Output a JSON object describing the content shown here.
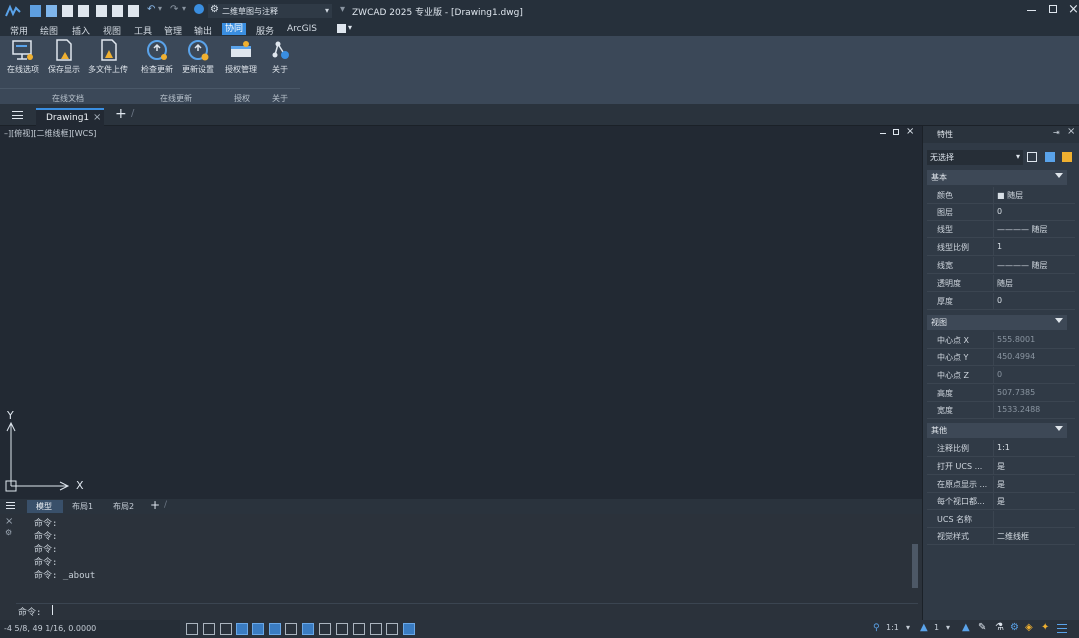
{
  "window": {
    "title": "ZWCAD 2025 专业版 - [Drawing1.dwg]",
    "workspace": "二维草图与注释"
  },
  "menu": {
    "items": [
      "常用",
      "绘图",
      "插入",
      "视图",
      "工具",
      "管理",
      "输出",
      "协同",
      "服务",
      "ArcGIS"
    ],
    "active": "协同"
  },
  "ribbon": {
    "buttons": [
      "在线选项",
      "保存显示",
      "多文件上传",
      "检查更新",
      "更新设置",
      "授权管理",
      "关于"
    ],
    "groups": [
      "在线文档",
      "在线更新",
      "授权",
      "关于"
    ]
  },
  "doc_tab": {
    "label": "Drawing1"
  },
  "viewport": {
    "label": "–][俯视][二维线框][WCS]",
    "axis_y": "Y",
    "axis_x": "X"
  },
  "layout_tabs": [
    "模型",
    "布局1",
    "布局2"
  ],
  "command": {
    "lines": [
      "命令:",
      "命令:",
      "命令:",
      "命令:",
      "命令: _about"
    ],
    "prompt": "命令:"
  },
  "status": {
    "coords": "-4 5/8, 49 1/16, 0.0000"
  },
  "properties": {
    "title": "特性",
    "selection": "无选择",
    "sections": {
      "basic": {
        "title": "基本",
        "rows": [
          {
            "k": "颜色",
            "v": "■ 随层"
          },
          {
            "k": "图层",
            "v": "0"
          },
          {
            "k": "线型",
            "v": "———— 随层"
          },
          {
            "k": "线型比例",
            "v": "1"
          },
          {
            "k": "线宽",
            "v": "———— 随层"
          },
          {
            "k": "透明度",
            "v": "随层"
          },
          {
            "k": "厚度",
            "v": "0"
          }
        ]
      },
      "view": {
        "title": "视图",
        "rows": [
          {
            "k": "中心点 X",
            "v": "555.8001"
          },
          {
            "k": "中心点 Y",
            "v": "450.4994"
          },
          {
            "k": "中心点 Z",
            "v": "0"
          },
          {
            "k": "高度",
            "v": "507.7385"
          },
          {
            "k": "宽度",
            "v": "1533.2488"
          }
        ]
      },
      "other": {
        "title": "其他",
        "rows": [
          {
            "k": "注释比例",
            "v": "1:1"
          },
          {
            "k": "打开 UCS ...",
            "v": "是"
          },
          {
            "k": "在原点显示 ...",
            "v": "是"
          },
          {
            "k": "每个视口都...",
            "v": "是"
          },
          {
            "k": "UCS 名称",
            "v": ""
          },
          {
            "k": "视觉样式",
            "v": "二维线框"
          }
        ]
      }
    }
  },
  "colors": {
    "accent": "#3a8ee0",
    "ribbon": "#3b4858",
    "canvas": "#222933"
  }
}
